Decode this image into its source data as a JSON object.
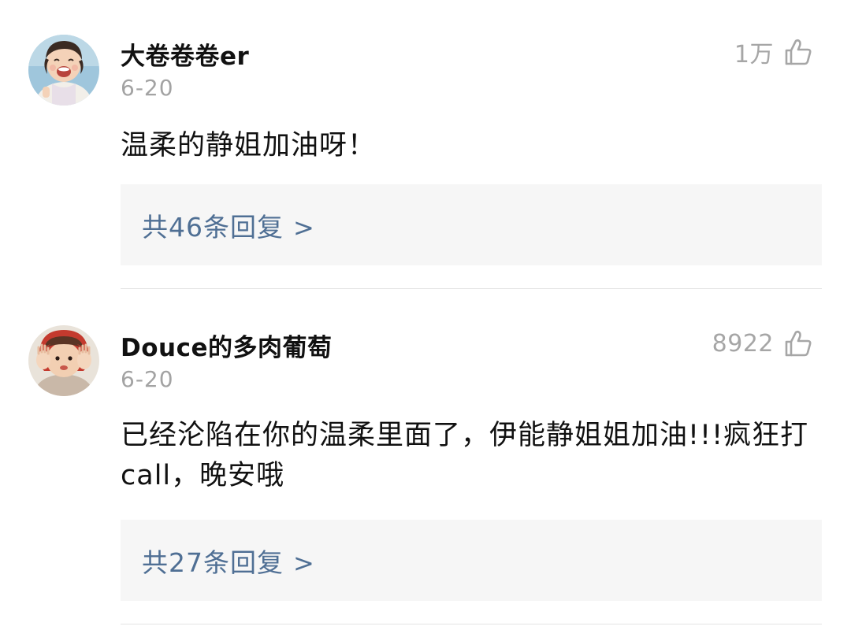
{
  "comments": [
    {
      "avatar_icon": "girl-laughing-avatar",
      "username": "大卷卷卷er",
      "date": "6-20",
      "likes": "1万",
      "like_icon": "thumbs-up-icon",
      "text": "温柔的静姐加油呀！",
      "replies_label": "共46条回复",
      "replies_chevron": ">"
    },
    {
      "avatar_icon": "girl-peekaboo-avatar",
      "username": "Douce的多肉葡萄",
      "date": "6-20",
      "likes": "8922",
      "like_icon": "thumbs-up-icon",
      "text": "已经沦陷在你的温柔里面了，伊能静姐姐加油!!!疯狂打call，晚安哦",
      "replies_label": "共27条回复",
      "replies_chevron": ">"
    }
  ],
  "colors": {
    "username": "#111111",
    "meta": "#a3a3a3",
    "link": "#4f6f94",
    "reply_bg": "#f6f6f6",
    "divider": "#e4e4e4"
  }
}
